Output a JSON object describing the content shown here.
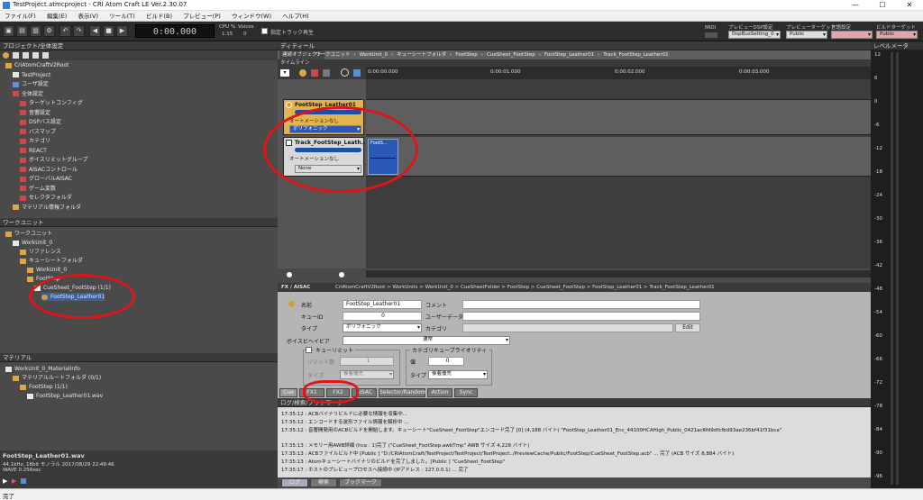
{
  "window": {
    "title": "TestProject.atmcproject - CRI Atom Craft LE Ver.2.30.07",
    "min": "—",
    "max": "☐",
    "close": "✕"
  },
  "menu": [
    "ファイル(F)",
    "編集(E)",
    "表示(V)",
    "ツール(T)",
    "ビルド(B)",
    "プレビュー(P)",
    "ウィンドウ(W)",
    "ヘルプ(H)"
  ],
  "toolbar": {
    "time": "0:00.000",
    "cpu_label": "CPU %",
    "cpu_value": "1.15",
    "voices_label": "Voices",
    "voices_value": "0",
    "solo_label": "指定トラック再生",
    "midi_label": "MIDI",
    "dsp_label": "プレビューDSP設定",
    "dsp_value": "DspBusSetting_0",
    "target_label": "プレビューターゲット",
    "target_value": "Public",
    "lang_label": "言語設定",
    "lang_value": "",
    "build_label": "ビルドターゲット",
    "build_value": "Public"
  },
  "project_panel": {
    "title": "プロジェクト/全体設定",
    "items": [
      {
        "label": "CriAtomCraftV2Root",
        "indent": 0,
        "icon": "folder"
      },
      {
        "label": "TestProject",
        "indent": 1,
        "icon": "white"
      },
      {
        "label": "ユーザ設定",
        "indent": 1,
        "icon": "blue"
      },
      {
        "label": "全体設定",
        "indent": 1,
        "icon": "red"
      },
      {
        "label": "ターゲットコンフィグ",
        "indent": 2,
        "icon": "red"
      },
      {
        "label": "音響設定",
        "indent": 2,
        "icon": "red"
      },
      {
        "label": "DSPバス設定",
        "indent": 2,
        "icon": "red"
      },
      {
        "label": "バスマップ",
        "indent": 2,
        "icon": "red"
      },
      {
        "label": "カテゴリ",
        "indent": 2,
        "icon": "red"
      },
      {
        "label": "REACT",
        "indent": 2,
        "icon": "red"
      },
      {
        "label": "ボイスリミットグループ",
        "indent": 2,
        "icon": "red"
      },
      {
        "label": "AISACコントロール",
        "indent": 2,
        "icon": "red"
      },
      {
        "label": "グローバルAISAC",
        "indent": 2,
        "icon": "red"
      },
      {
        "label": "ゲーム変数",
        "indent": 2,
        "icon": "red"
      },
      {
        "label": "セレクタフォルダ",
        "indent": 2,
        "icon": "red"
      },
      {
        "label": "マテリアル情報フォルダ",
        "indent": 1,
        "icon": "folder"
      }
    ]
  },
  "workunit_panel": {
    "title": "ワークユニット",
    "items": [
      {
        "label": "ワークユニット",
        "indent": 0,
        "icon": "folder"
      },
      {
        "label": "WorkUnit_0",
        "indent": 1,
        "icon": "white"
      },
      {
        "label": "リファレンス",
        "indent": 2,
        "icon": "folder"
      },
      {
        "label": "キューシートフォルダ",
        "indent": 2,
        "icon": "folder"
      },
      {
        "label": "WorkUnit_0",
        "indent": 3,
        "icon": "folder"
      },
      {
        "label": "FootStep",
        "indent": 3,
        "icon": "folder"
      },
      {
        "label": "CueSheet_FootStep (1/1)",
        "indent": 4,
        "icon": "white"
      },
      {
        "label": "FootStep_Leather01",
        "indent": 5,
        "icon": "gold",
        "selected": true
      }
    ]
  },
  "material_panel": {
    "title": "マテリアル",
    "items": [
      {
        "label": "WorkUnit_0_MaterialInfo",
        "indent": 0,
        "icon": "white"
      },
      {
        "label": "マテリアルルートフォルダ (0/1)",
        "indent": 1,
        "icon": "folder"
      },
      {
        "label": "FootStep (1/1)",
        "indent": 2,
        "icon": "folder"
      },
      {
        "label": "FootStep_Leather01.wav",
        "indent": 3,
        "icon": "white"
      }
    ],
    "info_name": "FootStep_Leather01.wav",
    "info_line1": "44.1kHz, 16bit モノラル  2017/08/29 22:49:46",
    "info_line2": "WAVE 0.256sec"
  },
  "editor": {
    "title": "ディティール",
    "tab": "連続オブジェクト",
    "breadcrumb": [
      "ワークユニット",
      "WorkUnit_0",
      "キューシートフォルダ",
      "FootStep",
      "CueSheet_FootStep",
      "FootStep_Leather01",
      "Track_FootStep_Leather01"
    ],
    "timeline_label": "タイムライン",
    "ruler": [
      "0:00:00.000",
      "0:00:01.000",
      "0:00:02.000",
      "0:00:03.000"
    ],
    "cue": {
      "name": "FootStep_Leather01",
      "automation": "オートメーションなし",
      "type": "ポリフォニック"
    },
    "track": {
      "name": "Track_FootStep_Leath...",
      "automation": "オートメーションなし",
      "none": "None",
      "wave_label": "FootS..."
    }
  },
  "fx_bar": {
    "title": "FX / AISAC",
    "path": "CriAtomCraftV2Root > WorkUnits > WorkUnit_0 > CueSheetFolder > FootStep > CueSheet_FootStep > FootStep_Leather01 > Track_FootStep_Leather01"
  },
  "props": {
    "name_label": "名前",
    "name_value": "FootStep_Leather01",
    "comment_label": "コメント",
    "cueid_label": "キューID",
    "cueid_value": "0",
    "userdata_label": "ユーザーデータ",
    "type_label": "タイプ",
    "type_value": "ポリフォニック",
    "category_label": "カテゴリ",
    "edit_label": "Edit",
    "voicebehavior_label": "ボイスビヘイビア",
    "voicebehavior_value": "通常",
    "cuelimit_label": "キューリミット",
    "limit_count_label": "リミット数",
    "limit_count_value": "1",
    "limit_type_label": "タイプ",
    "limit_type_value": "後着優先",
    "priority_group_label": "カテゴリキュープライオリティ",
    "priority_value_label": "値",
    "priority_value": "0",
    "priority_type_label": "タイプ",
    "priority_type_value": "後着優先",
    "tabs": [
      "Cue",
      "FX1",
      "FX2",
      "AISAC",
      "Selector/Random",
      "Action",
      "Sync"
    ]
  },
  "log": {
    "title": "ログ/検索/ブックマーク",
    "lines": [
      "17:35:12 :  ACBバイナリビルドに必要な情報を収集中...",
      "17:35:12 :  エンコードする波形ファイル情報を解析中 ...",
      "17:35:12 :  音響開発用のACBビルドを開始します。キューシート\"CueSheet_FootStep\"エンコード完了 [0] (4,188 バイト) \"FootStep_Leather01_Enc_44100HCAHigh_Public_0421ac6fd9dfcfbd93ae236bf41f31bca\"",
      "17:35:13 :  メモリー用AWB詳細 (hca : 1)完了 (\"CueSheet_FootStep.awbTmp\" AWB サイズ 4,228 バイト)",
      "17:35:13 :  ACBファイルビルド中 [Public ] \"D:/CRIAtomCraft/TestProject/TestProject/TestProject../PreviewCache/Public/FootStep/CueSheet_FootStep.acb\" ... 完了 (ACB サイズ 8,884 バイト)",
      "17:35:13 :  Atomキューシートバイナリのビルドを完了しました。[Public ] \"CueSheet_FootStep\"",
      "17:35:17 :  ホストのプレビュープロセスへ接続中 (IPアドレス : 127.0.0.1) ... 完了"
    ],
    "tabs": [
      "ログ",
      "検索",
      "ブックマーク"
    ]
  },
  "meter": {
    "title": "レベルメータ",
    "ticks": [
      "12",
      "6",
      "0",
      "-6",
      "-12",
      "-18",
      "-24",
      "-30",
      "-36",
      "-42",
      "-48",
      "-54",
      "-60",
      "-66",
      "-72",
      "-78",
      "-84",
      "-90",
      "-96"
    ]
  },
  "status": {
    "text": "完了"
  }
}
